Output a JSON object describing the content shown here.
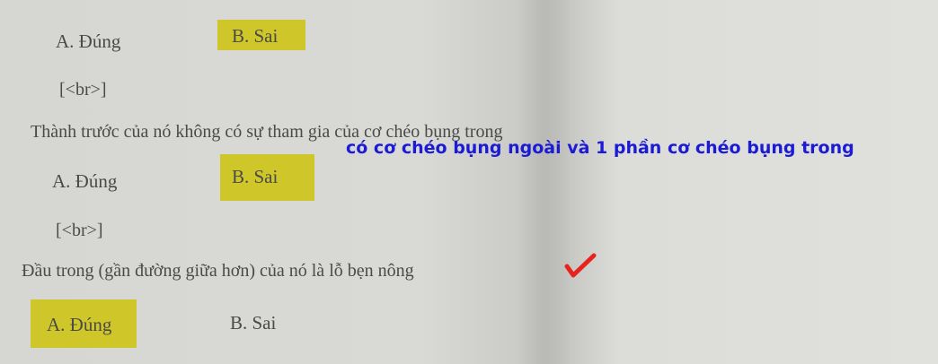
{
  "questions": [
    {
      "option_a": "A. Đúng",
      "option_b": "B. Sai"
    },
    {
      "break_tag": "[<br>]",
      "statement": "Thành trước của nó không có sự tham gia của cơ chéo bụng trong",
      "annotation": "có cơ chéo bụng ngoài và 1 phần cơ chéo bụng trong",
      "option_a": "A. Đúng",
      "option_b": "B. Sai"
    },
    {
      "break_tag": "[<br>]",
      "statement": "Đầu trong (gần đường giữa hơn) của nó là lỗ bẹn nông",
      "option_a": "A. Đúng",
      "option_b": "B. Sai"
    }
  ],
  "colors": {
    "highlight": "#cfc72a",
    "annotation": "#1b1bd6",
    "checkmark": "#e8221c"
  }
}
